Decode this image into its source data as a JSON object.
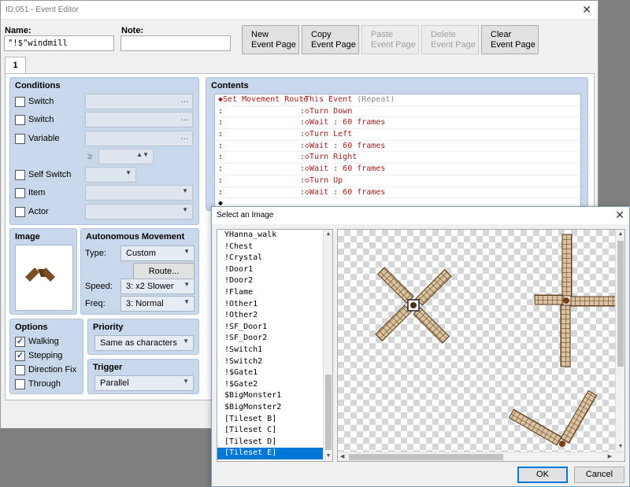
{
  "editor": {
    "title": "ID:051 - Event Editor",
    "close": "✕",
    "name_label": "Name:",
    "name_value": "\"!$\"windmill",
    "note_label": "Note:",
    "note_value": "",
    "toolbar": {
      "new_line1": "New",
      "new_line2": "Event Page",
      "copy_line1": "Copy",
      "copy_line2": "Event Page",
      "paste_line1": "Paste",
      "paste_line2": "Event Page",
      "delete_line1": "Delete",
      "delete_line2": "Event Page",
      "clear_line1": "Clear",
      "clear_line2": "Event Page"
    },
    "tab": "1",
    "conditions": {
      "title": "Conditions",
      "switch1": "Switch",
      "switch2": "Switch",
      "variable": "Variable",
      "gte": "≥",
      "self_switch": "Self Switch",
      "item": "Item",
      "actor": "Actor",
      "ellipsis": "..."
    },
    "image": {
      "title": "Image"
    },
    "autonomous": {
      "title": "Autonomous Movement",
      "type_label": "Type:",
      "type_value": "Custom",
      "route_button": "Route...",
      "speed_label": "Speed:",
      "speed_value": "3: x2 Slower",
      "freq_label": "Freq:",
      "freq_value": "3: Normal"
    },
    "options": {
      "title": "Options",
      "walking": "Walking",
      "walking_checked": "✓",
      "stepping": "Stepping",
      "stepping_checked": "✓",
      "direction_fix": "Direction Fix",
      "through": "Through"
    },
    "priority": {
      "title": "Priority",
      "value": "Same as characters"
    },
    "trigger": {
      "title": "Trigger",
      "value": "Parallel"
    },
    "contents": {
      "title": "Contents",
      "first": {
        "a": "◆Set Movement Route",
        "b": ":This Event",
        "c": " (Repeat)"
      },
      "rows": [
        {
          "a": ":",
          "b": ":◇Turn Down"
        },
        {
          "a": ":",
          "b": ":◇Wait : 60 frames"
        },
        {
          "a": ":",
          "b": ":◇Turn Left"
        },
        {
          "a": ":",
          "b": ":◇Wait : 60 frames"
        },
        {
          "a": ":",
          "b": ":◇Turn Right"
        },
        {
          "a": ":",
          "b": ":◇Wait : 60 frames"
        },
        {
          "a": ":",
          "b": ":◇Turn Up"
        },
        {
          "a": ":",
          "b": ":◇Wait : 60 frames"
        }
      ],
      "last": "◆"
    }
  },
  "dialog": {
    "title": "Select an Image",
    "close": "✕",
    "files": [
      "YHanna_walk",
      "!Chest",
      "!Crystal",
      "!Door1",
      "!Door2",
      "!Flame",
      "!Other1",
      "!Other2",
      "!SF_Door1",
      "!SF_Door2",
      "!Switch1",
      "!Switch2",
      "!$Gate1",
      "!$Gate2",
      "$BigMonster1",
      "$BigMonster2",
      "[Tileset B]",
      "[Tileset C]",
      "[Tileset D]",
      "[Tileset E]"
    ],
    "selected_index": 19,
    "ok": "OK",
    "cancel": "Cancel"
  },
  "colors": {
    "panel": "#c9d7ea",
    "selection": "#0078d7",
    "command_text": "#a12020",
    "blade": "#6b4a2a"
  }
}
